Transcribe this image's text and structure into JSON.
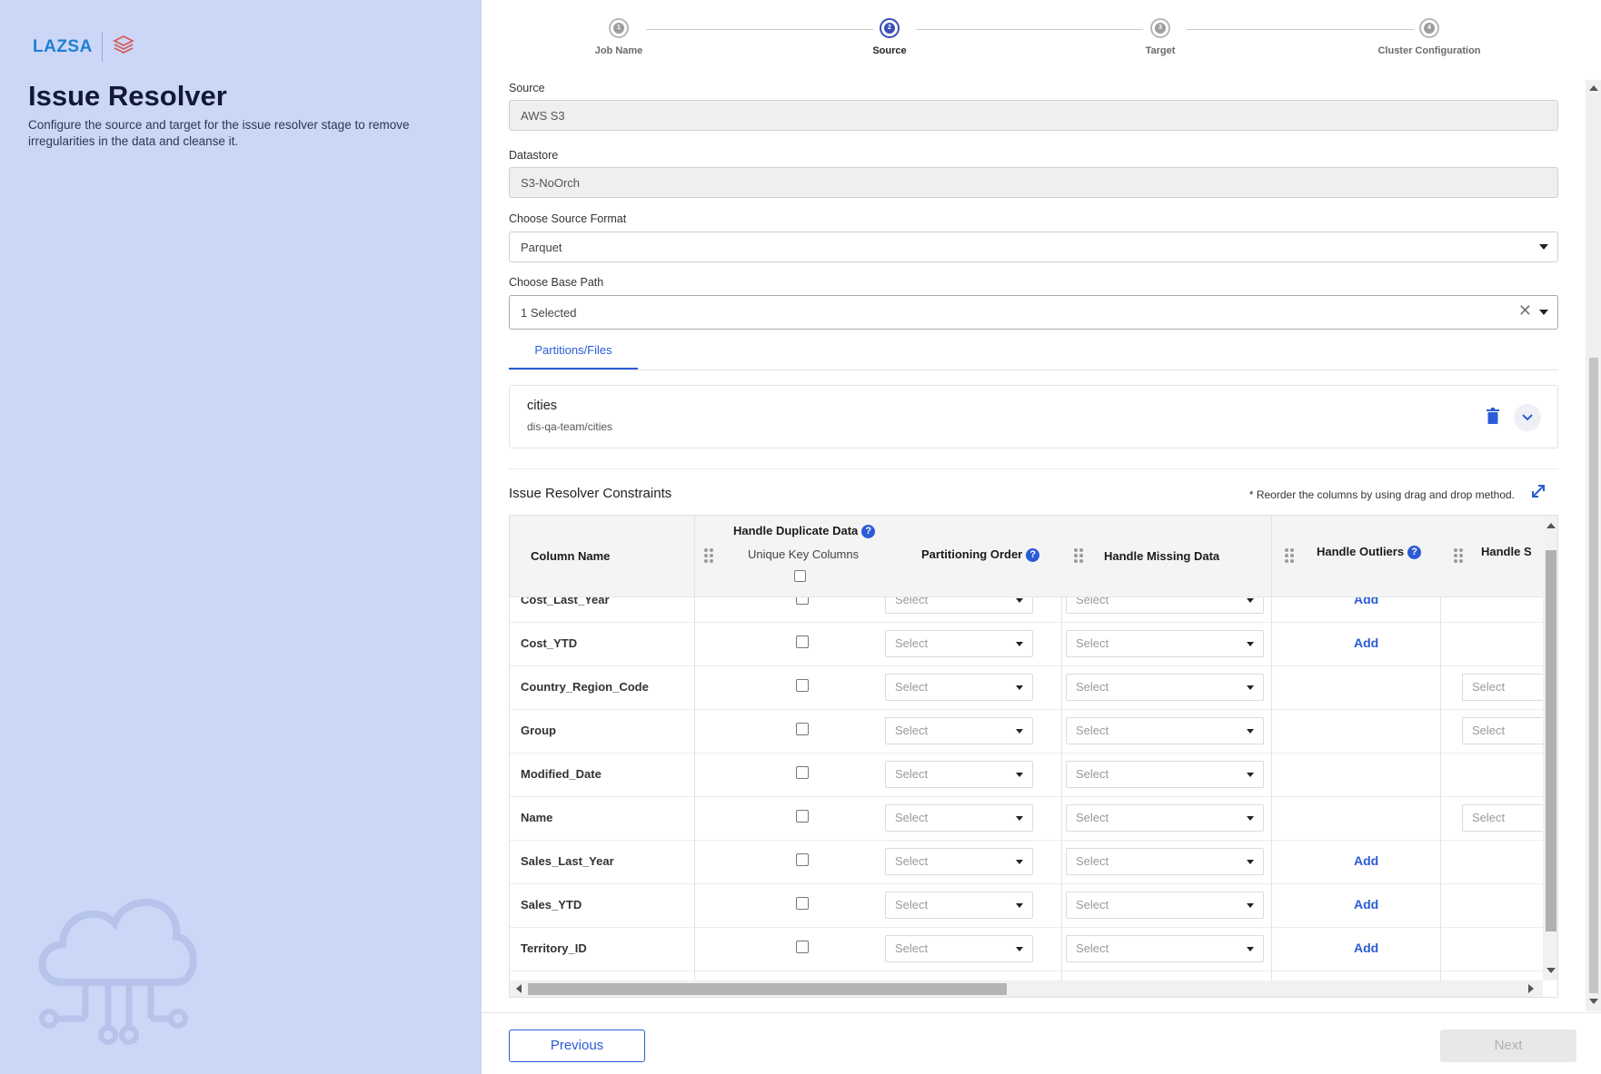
{
  "brand": {
    "logo_text": "LAZSA",
    "accent": "#1f7fd1"
  },
  "sidebar": {
    "title": "Issue Resolver",
    "description": "Configure the source and target for the issue resolver stage to remove irregularities in the data and cleanse it."
  },
  "stepper": {
    "steps": [
      {
        "num": "1",
        "label": "Job Name",
        "state": "complete"
      },
      {
        "num": "2",
        "label": "Source",
        "state": "active"
      },
      {
        "num": "3",
        "label": "Target",
        "state": "pending"
      },
      {
        "num": "4",
        "label": "Cluster Configuration",
        "state": "pending"
      }
    ]
  },
  "form": {
    "source": {
      "label": "Source",
      "value": "AWS S3"
    },
    "datastore": {
      "label": "Datastore",
      "value": "S3-NoOrch"
    },
    "format": {
      "label": "Choose Source Format",
      "value": "Parquet"
    },
    "base_path": {
      "label": "Choose Base Path",
      "value": "1 Selected"
    }
  },
  "tabs": {
    "partitions": "Partitions/Files"
  },
  "partition_card": {
    "title": "cities",
    "path": "dis-qa-team/cities"
  },
  "constraints": {
    "title": "Issue Resolver Constraints",
    "note": "* Reorder the columns by using drag and drop method.",
    "headers": {
      "column_name": "Column Name",
      "handle_duplicate": "Handle Duplicate Data",
      "unique_key": "Unique Key Columns",
      "partitioning_order": "Partitioning Order",
      "handle_missing": "Handle Missing Data",
      "handle_outliers": "Handle Outliers",
      "handle_s": "Handle S"
    },
    "select_placeholder": "Select",
    "add_label": "Add",
    "rows": [
      {
        "name": "Cost_Last_Year",
        "outliers": "add",
        "extra": ""
      },
      {
        "name": "Cost_YTD",
        "outliers": "add",
        "extra": ""
      },
      {
        "name": "Country_Region_Code",
        "outliers": "",
        "extra": "select"
      },
      {
        "name": "Group",
        "outliers": "",
        "extra": "select"
      },
      {
        "name": "Modified_Date",
        "outliers": "",
        "extra": ""
      },
      {
        "name": "Name",
        "outliers": "",
        "extra": "select"
      },
      {
        "name": "Sales_Last_Year",
        "outliers": "add",
        "extra": ""
      },
      {
        "name": "Sales_YTD",
        "outliers": "add",
        "extra": ""
      },
      {
        "name": "Territory_ID",
        "outliers": "add",
        "extra": ""
      }
    ]
  },
  "footer": {
    "previous": "Previous",
    "next": "Next"
  }
}
